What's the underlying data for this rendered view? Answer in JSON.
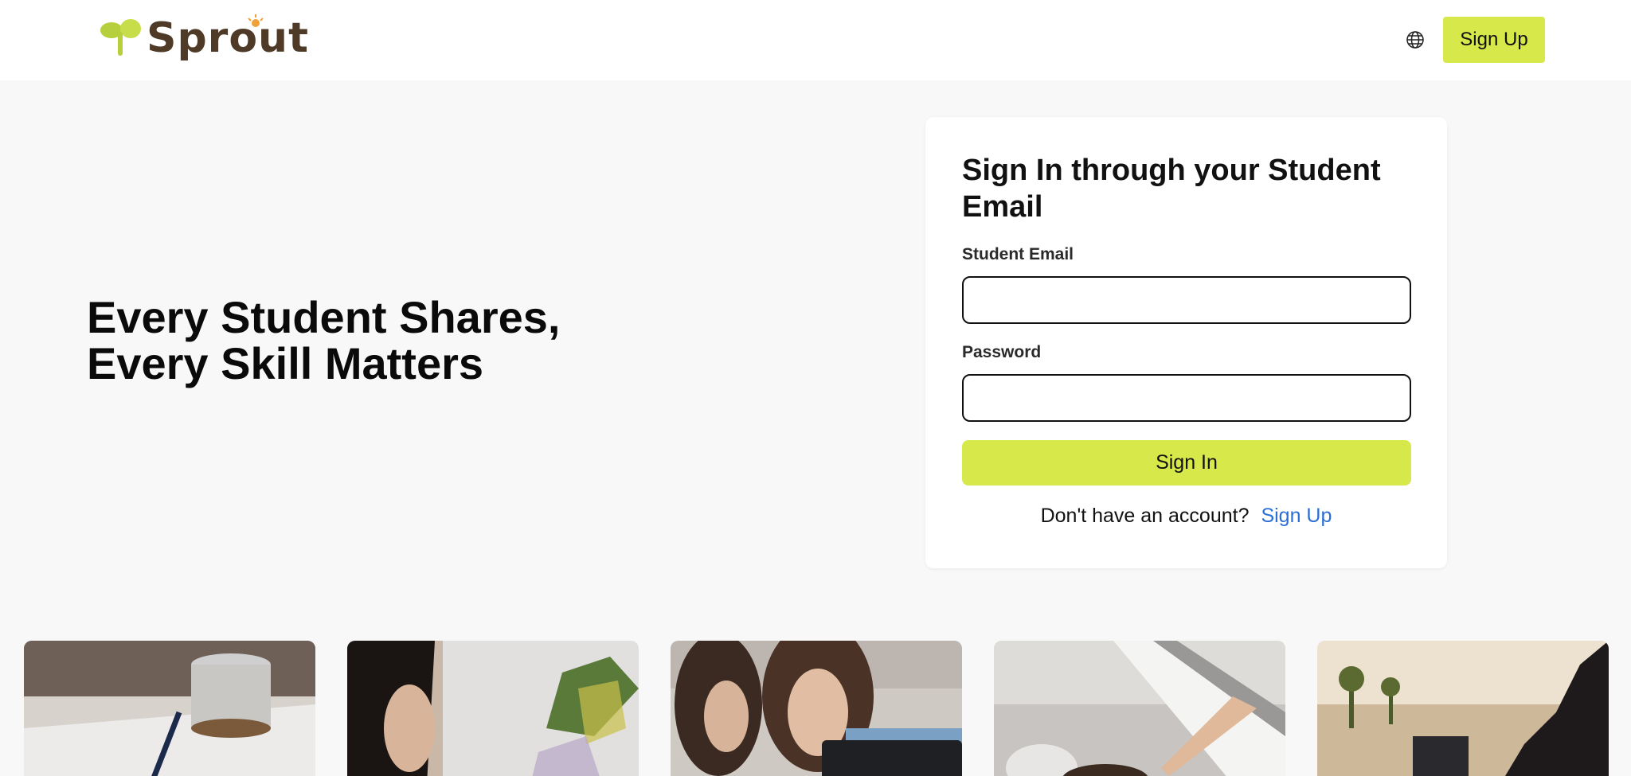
{
  "header": {
    "logo_text": "Sprout",
    "signup_label": "Sign Up",
    "language_icon": "globe-icon"
  },
  "hero": {
    "title_line1": "Every Student Shares,",
    "title_line2": "Every Skill Matters"
  },
  "signin_card": {
    "title": "Sign In through your Student Email",
    "email_label": "Student Email",
    "email_value": "",
    "password_label": "Password",
    "password_value": "",
    "signin_label": "Sign In",
    "no_account_text": "Don't have an account?",
    "signup_link": "Sign Up"
  },
  "gallery": {
    "tiles": [
      "desk-coffee-photo",
      "student-painting-photo",
      "students-laptop-photo",
      "cooking-window-photo",
      "outdoor-laptop-photo"
    ]
  },
  "colors": {
    "accent": "#d6e84a",
    "link": "#2b6fd6",
    "logo_brown": "#4e3a26",
    "logo_green": "#b6cf3c",
    "background": "#f8f8f8"
  }
}
